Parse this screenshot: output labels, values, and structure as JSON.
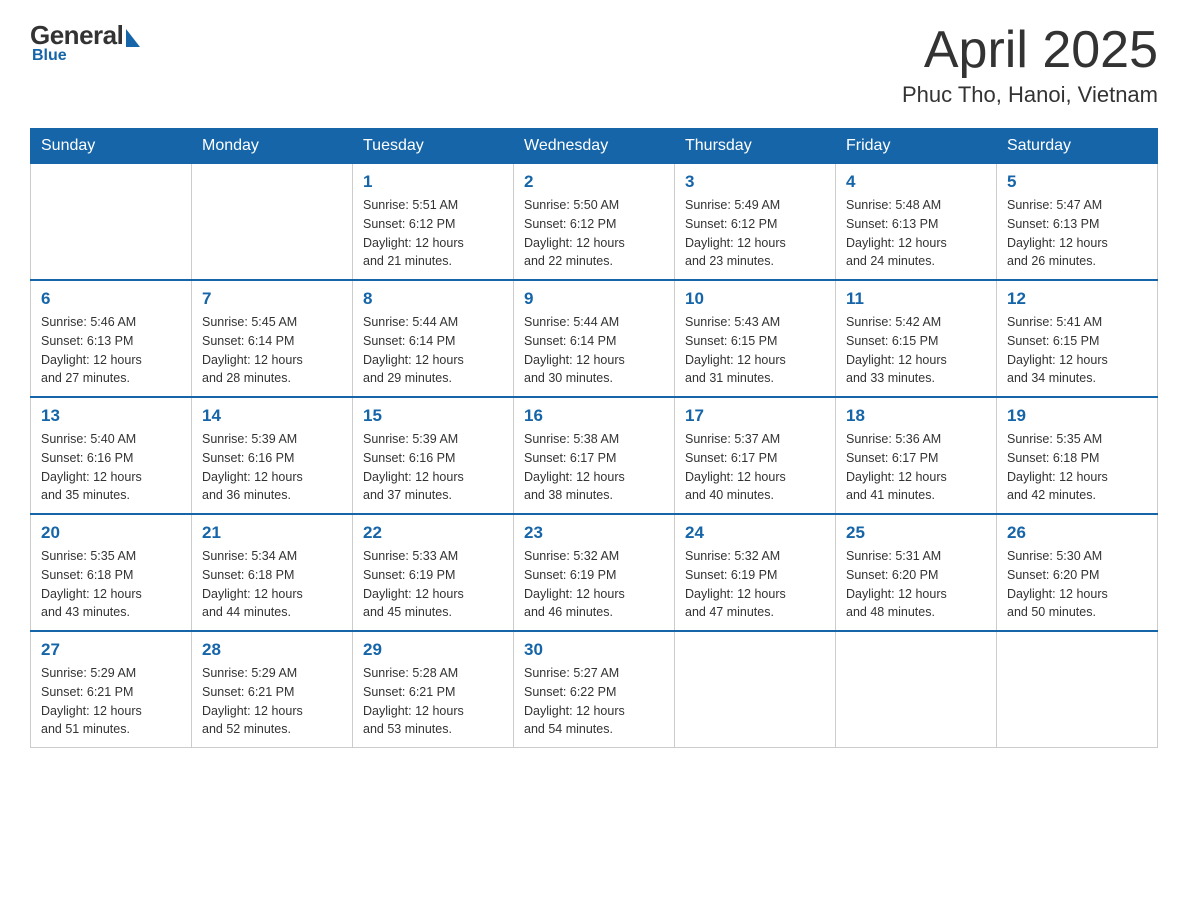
{
  "logo": {
    "general": "General",
    "blue": "Blue"
  },
  "title": "April 2025",
  "subtitle": "Phuc Tho, Hanoi, Vietnam",
  "weekdays": [
    "Sunday",
    "Monday",
    "Tuesday",
    "Wednesday",
    "Thursday",
    "Friday",
    "Saturday"
  ],
  "weeks": [
    [
      {
        "day": "",
        "info": ""
      },
      {
        "day": "",
        "info": ""
      },
      {
        "day": "1",
        "info": "Sunrise: 5:51 AM\nSunset: 6:12 PM\nDaylight: 12 hours\nand 21 minutes."
      },
      {
        "day": "2",
        "info": "Sunrise: 5:50 AM\nSunset: 6:12 PM\nDaylight: 12 hours\nand 22 minutes."
      },
      {
        "day": "3",
        "info": "Sunrise: 5:49 AM\nSunset: 6:12 PM\nDaylight: 12 hours\nand 23 minutes."
      },
      {
        "day": "4",
        "info": "Sunrise: 5:48 AM\nSunset: 6:13 PM\nDaylight: 12 hours\nand 24 minutes."
      },
      {
        "day": "5",
        "info": "Sunrise: 5:47 AM\nSunset: 6:13 PM\nDaylight: 12 hours\nand 26 minutes."
      }
    ],
    [
      {
        "day": "6",
        "info": "Sunrise: 5:46 AM\nSunset: 6:13 PM\nDaylight: 12 hours\nand 27 minutes."
      },
      {
        "day": "7",
        "info": "Sunrise: 5:45 AM\nSunset: 6:14 PM\nDaylight: 12 hours\nand 28 minutes."
      },
      {
        "day": "8",
        "info": "Sunrise: 5:44 AM\nSunset: 6:14 PM\nDaylight: 12 hours\nand 29 minutes."
      },
      {
        "day": "9",
        "info": "Sunrise: 5:44 AM\nSunset: 6:14 PM\nDaylight: 12 hours\nand 30 minutes."
      },
      {
        "day": "10",
        "info": "Sunrise: 5:43 AM\nSunset: 6:15 PM\nDaylight: 12 hours\nand 31 minutes."
      },
      {
        "day": "11",
        "info": "Sunrise: 5:42 AM\nSunset: 6:15 PM\nDaylight: 12 hours\nand 33 minutes."
      },
      {
        "day": "12",
        "info": "Sunrise: 5:41 AM\nSunset: 6:15 PM\nDaylight: 12 hours\nand 34 minutes."
      }
    ],
    [
      {
        "day": "13",
        "info": "Sunrise: 5:40 AM\nSunset: 6:16 PM\nDaylight: 12 hours\nand 35 minutes."
      },
      {
        "day": "14",
        "info": "Sunrise: 5:39 AM\nSunset: 6:16 PM\nDaylight: 12 hours\nand 36 minutes."
      },
      {
        "day": "15",
        "info": "Sunrise: 5:39 AM\nSunset: 6:16 PM\nDaylight: 12 hours\nand 37 minutes."
      },
      {
        "day": "16",
        "info": "Sunrise: 5:38 AM\nSunset: 6:17 PM\nDaylight: 12 hours\nand 38 minutes."
      },
      {
        "day": "17",
        "info": "Sunrise: 5:37 AM\nSunset: 6:17 PM\nDaylight: 12 hours\nand 40 minutes."
      },
      {
        "day": "18",
        "info": "Sunrise: 5:36 AM\nSunset: 6:17 PM\nDaylight: 12 hours\nand 41 minutes."
      },
      {
        "day": "19",
        "info": "Sunrise: 5:35 AM\nSunset: 6:18 PM\nDaylight: 12 hours\nand 42 minutes."
      }
    ],
    [
      {
        "day": "20",
        "info": "Sunrise: 5:35 AM\nSunset: 6:18 PM\nDaylight: 12 hours\nand 43 minutes."
      },
      {
        "day": "21",
        "info": "Sunrise: 5:34 AM\nSunset: 6:18 PM\nDaylight: 12 hours\nand 44 minutes."
      },
      {
        "day": "22",
        "info": "Sunrise: 5:33 AM\nSunset: 6:19 PM\nDaylight: 12 hours\nand 45 minutes."
      },
      {
        "day": "23",
        "info": "Sunrise: 5:32 AM\nSunset: 6:19 PM\nDaylight: 12 hours\nand 46 minutes."
      },
      {
        "day": "24",
        "info": "Sunrise: 5:32 AM\nSunset: 6:19 PM\nDaylight: 12 hours\nand 47 minutes."
      },
      {
        "day": "25",
        "info": "Sunrise: 5:31 AM\nSunset: 6:20 PM\nDaylight: 12 hours\nand 48 minutes."
      },
      {
        "day": "26",
        "info": "Sunrise: 5:30 AM\nSunset: 6:20 PM\nDaylight: 12 hours\nand 50 minutes."
      }
    ],
    [
      {
        "day": "27",
        "info": "Sunrise: 5:29 AM\nSunset: 6:21 PM\nDaylight: 12 hours\nand 51 minutes."
      },
      {
        "day": "28",
        "info": "Sunrise: 5:29 AM\nSunset: 6:21 PM\nDaylight: 12 hours\nand 52 minutes."
      },
      {
        "day": "29",
        "info": "Sunrise: 5:28 AM\nSunset: 6:21 PM\nDaylight: 12 hours\nand 53 minutes."
      },
      {
        "day": "30",
        "info": "Sunrise: 5:27 AM\nSunset: 6:22 PM\nDaylight: 12 hours\nand 54 minutes."
      },
      {
        "day": "",
        "info": ""
      },
      {
        "day": "",
        "info": ""
      },
      {
        "day": "",
        "info": ""
      }
    ]
  ]
}
